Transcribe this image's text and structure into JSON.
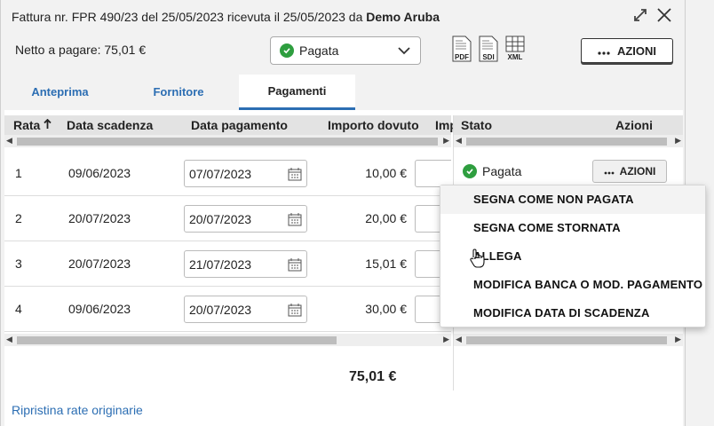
{
  "header": {
    "title_prefix": "Fattura nr. FPR 490/23 del 25/05/2023 ricevuta il 25/05/2023 da",
    "title_vendor": "Demo Aruba",
    "netto": "Netto a pagare: 75,01 €",
    "status_value": "Pagata",
    "doc_icons": [
      "PDF",
      "SDI",
      "XML"
    ],
    "azioni_label": "AZIONI",
    "icons": [
      "expand-icon",
      "close-icon"
    ]
  },
  "tabs": [
    {
      "label": "Anteprima"
    },
    {
      "label": "Fornitore"
    },
    {
      "label": "Pagamenti",
      "active": true
    }
  ],
  "table": {
    "columns": {
      "rata": "Rata",
      "scadenza": "Data scadenza",
      "pagamento": "Data pagamento",
      "importo": "Importo dovuto",
      "imp": "Imp"
    },
    "rows": [
      {
        "rata": "1",
        "scadenza": "09/06/2023",
        "pagamento": "07/07/2023",
        "importo": "10,00 €"
      },
      {
        "rata": "2",
        "scadenza": "20/07/2023",
        "pagamento": "20/07/2023",
        "importo": "20,00 €"
      },
      {
        "rata": "3",
        "scadenza": "20/07/2023",
        "pagamento": "21/07/2023",
        "importo": "15,01 €"
      },
      {
        "rata": "4",
        "scadenza": "09/06/2023",
        "pagamento": "20/07/2023",
        "importo": "30,00 €"
      }
    ],
    "total": "75,01 €"
  },
  "right_table": {
    "columns": {
      "stato": "Stato",
      "azioni": "Azioni"
    },
    "row1_state": "Pagata",
    "row1_action": "AZIONI"
  },
  "menu": {
    "items": [
      "SEGNA COME NON PAGATA",
      "SEGNA COME STORNATA",
      "ALLEGA",
      "MODIFICA BANCA O MOD. PAGAMENTO",
      "MODIFICA DATA DI SCADENZA"
    ]
  },
  "footer": {
    "restore_link": "Ripristina rate originarie"
  },
  "colors": {
    "accent": "#2c6eb3",
    "success": "#2e9e3f"
  }
}
